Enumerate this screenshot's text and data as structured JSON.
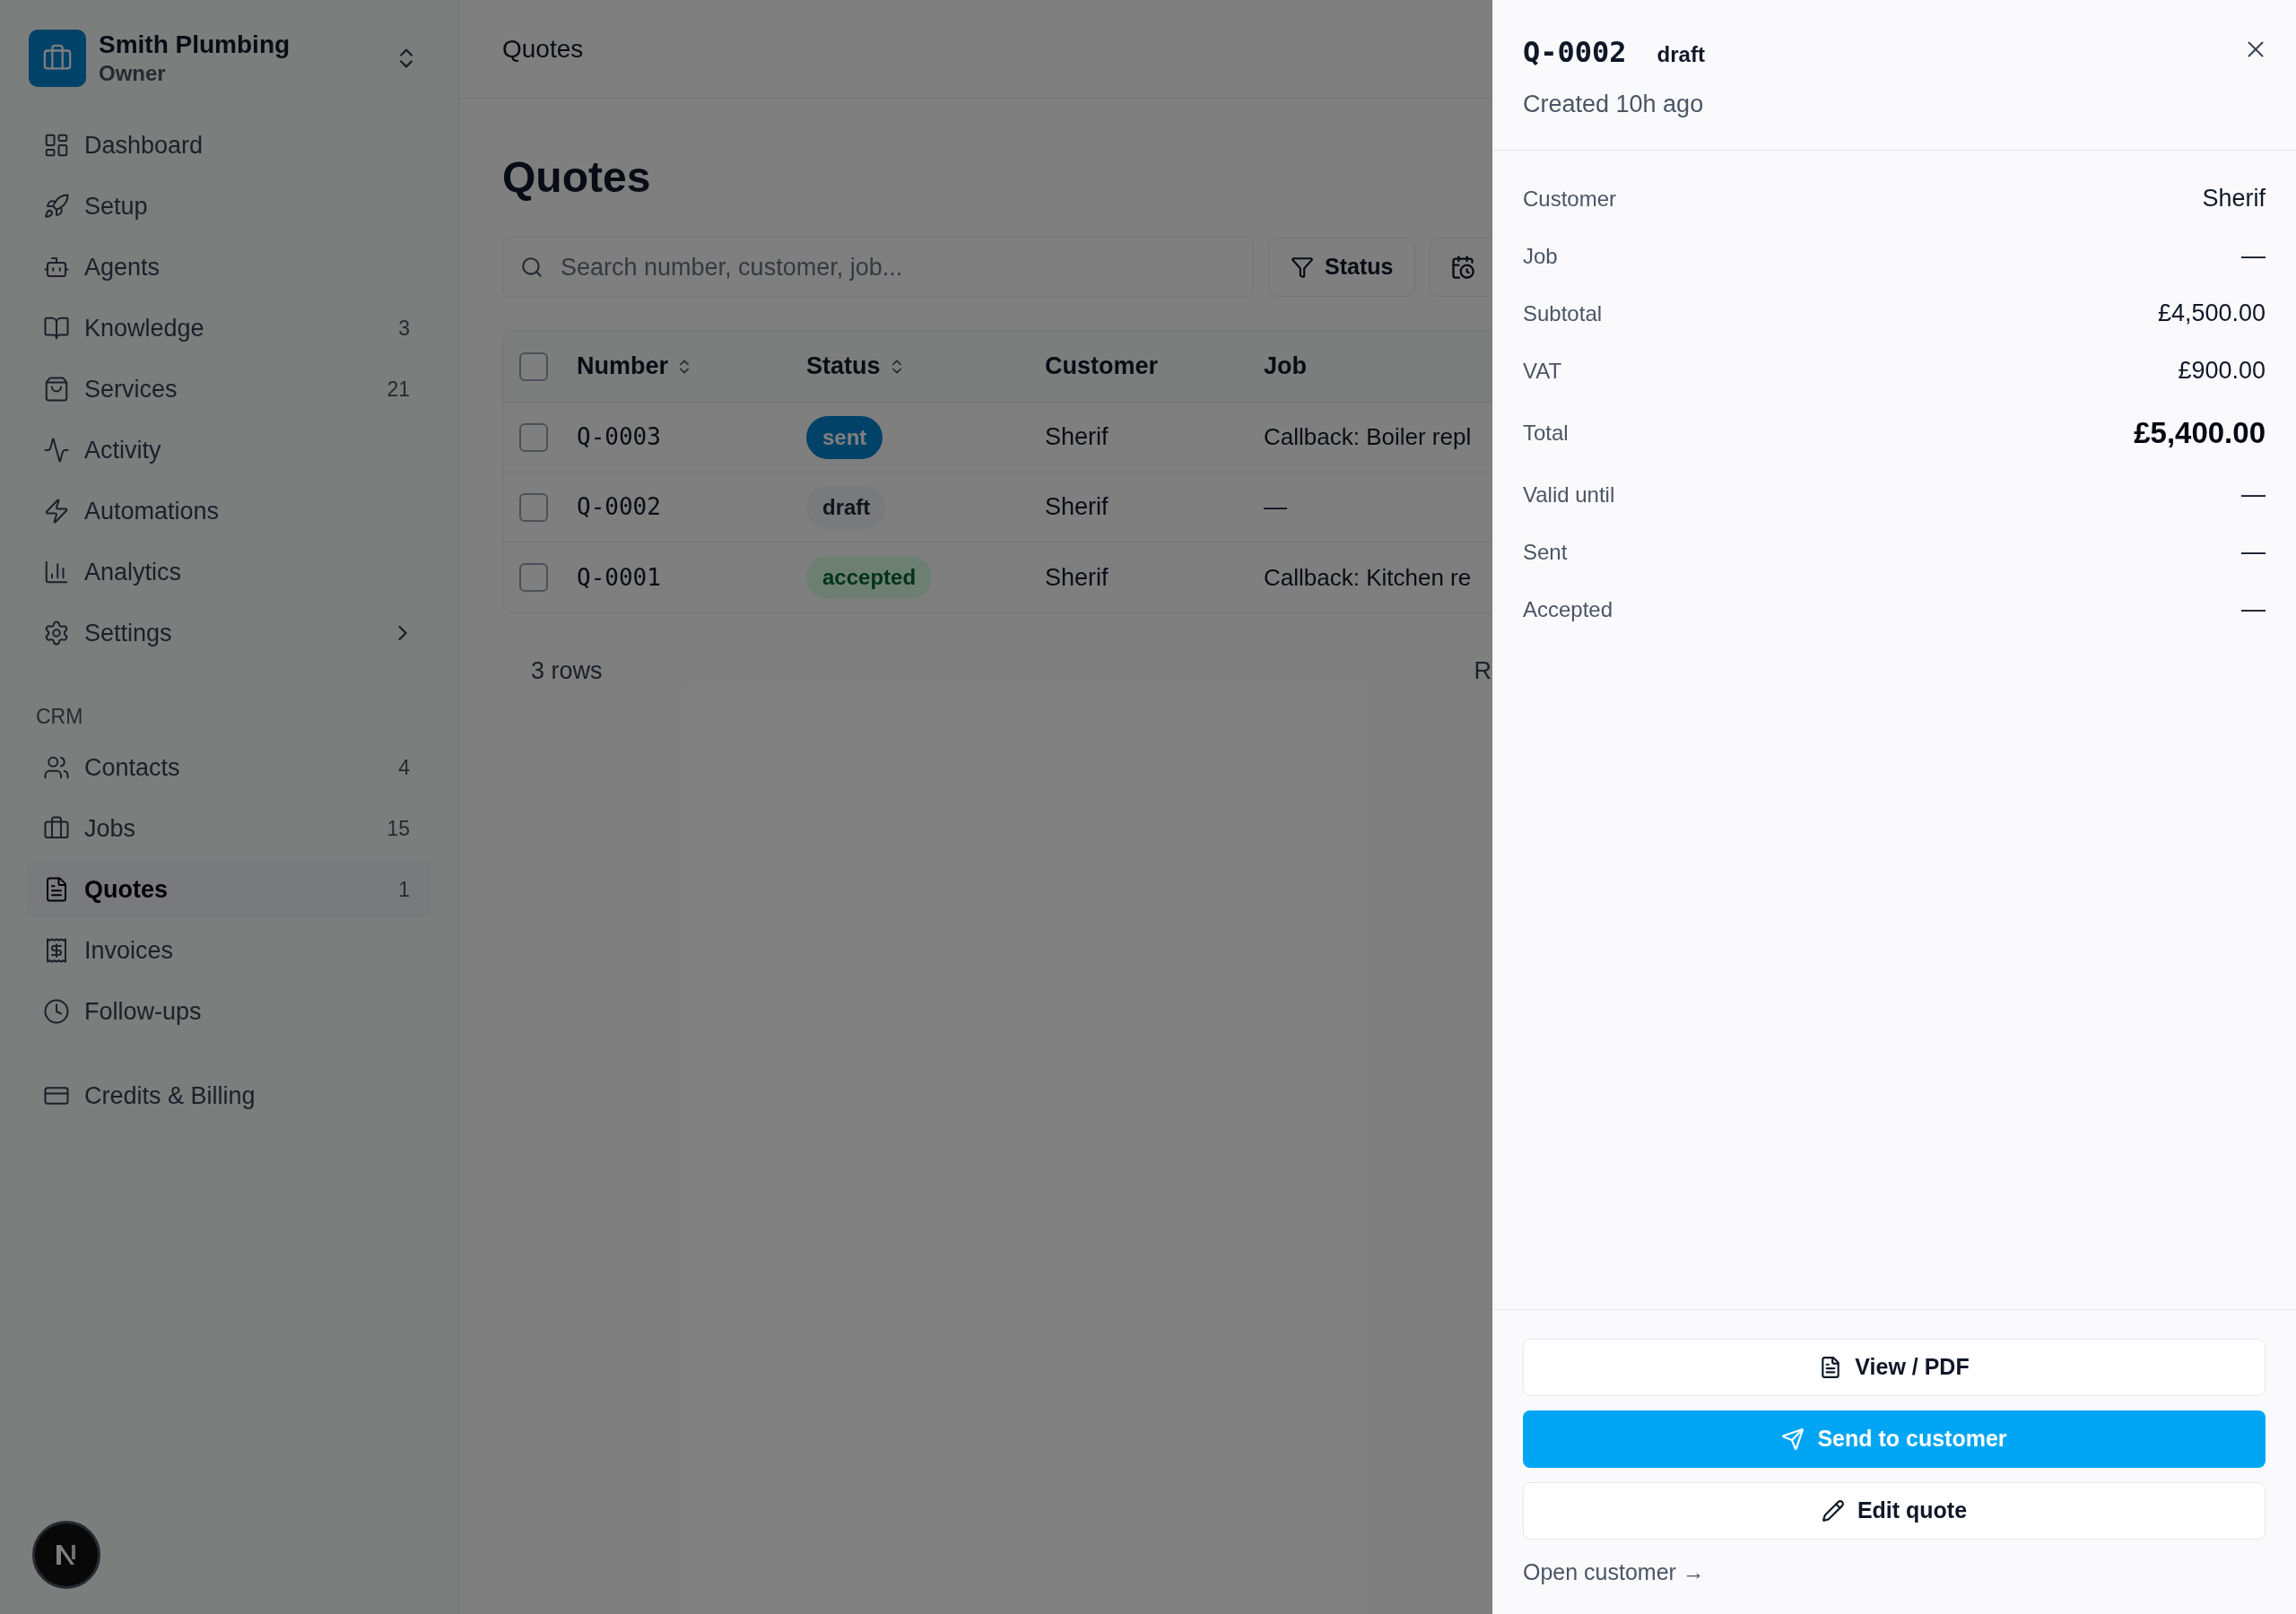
{
  "sidebar": {
    "org": {
      "name": "Smith Plumbing",
      "role": "Owner"
    },
    "sections": [
      {
        "items": [
          {
            "label": "Dashboard",
            "selected": false
          },
          {
            "label": "Setup",
            "selected": false
          },
          {
            "label": "Agents",
            "selected": false
          },
          {
            "label": "Knowledge",
            "count": "3",
            "selected": false
          },
          {
            "label": "Services",
            "count": "21",
            "selected": false
          },
          {
            "label": "Activity",
            "selected": false
          },
          {
            "label": "Automations",
            "selected": false
          },
          {
            "label": "Analytics",
            "selected": false
          },
          {
            "label": "Settings",
            "kind": "group",
            "selected": false
          }
        ]
      },
      {
        "heading": "CRM",
        "items": [
          {
            "label": "Contacts",
            "count": "4",
            "selected": false
          },
          {
            "label": "Jobs",
            "count": "15",
            "selected": false
          },
          {
            "label": "Quotes",
            "count": "1",
            "selected": true
          },
          {
            "label": "Invoices",
            "selected": false
          },
          {
            "label": "Follow-ups",
            "selected": false
          }
        ]
      },
      {
        "items": [
          {
            "label": "Credits & Billing",
            "selected": false
          }
        ]
      }
    ]
  },
  "header": {
    "title": "Quotes"
  },
  "page": {
    "title": "Quotes",
    "search": {
      "placeholder": "Search number, customer, job..."
    },
    "filters": [
      {
        "label": "Status"
      }
    ],
    "table": {
      "select_all": {
        "checked": false
      },
      "columns": [
        {
          "label": "Number",
          "sortable": true
        },
        {
          "label": "Status",
          "sortable": true
        },
        {
          "label": "Customer",
          "sortable": false
        },
        {
          "label": "Job",
          "sortable": false
        }
      ],
      "rows": [
        {
          "checked": false,
          "number": "Q-0003",
          "status": "sent",
          "kind": "info",
          "customer": "Sherif",
          "job": "Callback: Boiler repl"
        },
        {
          "checked": false,
          "number": "Q-0002",
          "status": "draft",
          "kind": "neutral",
          "customer": "Sherif",
          "job": "—"
        },
        {
          "checked": false,
          "number": "Q-0001",
          "status": "accepted",
          "kind": "success",
          "customer": "Sherif",
          "job": "Callback: Kitchen re"
        }
      ]
    },
    "footer": {
      "count": "3 rows",
      "pagination": "R"
    }
  },
  "panel": {
    "number": "Q-0002",
    "status": "draft",
    "created": "Created 10h ago",
    "fields": [
      {
        "label": "Customer",
        "value": "Sherif",
        "emphasis": false
      },
      {
        "label": "Job",
        "value": "—",
        "emphasis": false
      },
      {
        "label": "Subtotal",
        "value": "£4,500.00",
        "emphasis": false
      },
      {
        "label": "VAT",
        "value": "£900.00",
        "emphasis": false
      },
      {
        "label": "Total",
        "value": "£5,400.00",
        "emphasis": true
      },
      {
        "label": "Valid until",
        "value": "—",
        "emphasis": false
      },
      {
        "label": "Sent",
        "value": "—",
        "emphasis": false
      },
      {
        "label": "Accepted",
        "value": "—",
        "emphasis": false
      }
    ],
    "actions": [
      {
        "label": "View / PDF",
        "kind": "outline"
      },
      {
        "label": "Send to customer",
        "kind": "primary"
      },
      {
        "label": "Edit quote",
        "kind": "outline"
      }
    ],
    "link": "Open customer →"
  }
}
